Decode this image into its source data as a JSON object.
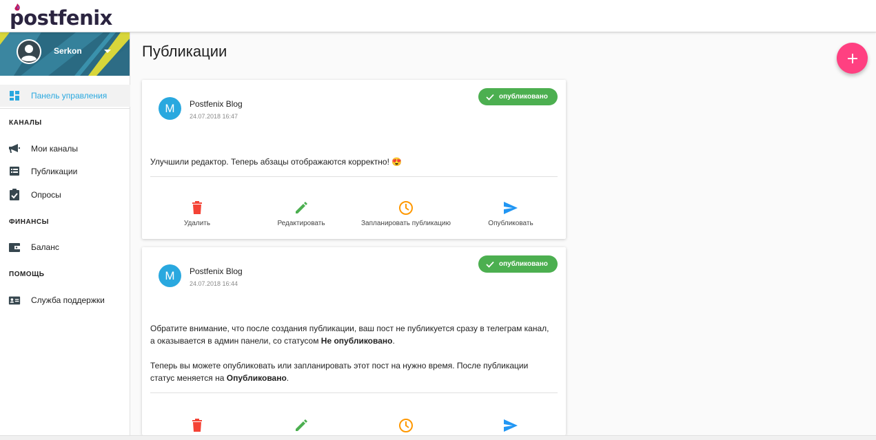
{
  "app": {
    "logo_text": "postfenix"
  },
  "user": {
    "name": "Serkon"
  },
  "sidebar": {
    "active": {
      "label": "Панель управления",
      "icon": "dashboard-icon"
    },
    "sections": [
      {
        "title": "КАНАЛЫ",
        "items": [
          {
            "label": "Мои каналы",
            "icon": "megaphone-icon"
          },
          {
            "label": "Публикации",
            "icon": "list-icon"
          },
          {
            "label": "Опросы",
            "icon": "clipboard-check-icon"
          }
        ]
      },
      {
        "title": "ФИНАНСЫ",
        "items": [
          {
            "label": "Баланс",
            "icon": "wallet-icon"
          }
        ]
      },
      {
        "title": "ПОМОЩЬ",
        "items": [
          {
            "label": "Служба поддержки",
            "icon": "contact-card-icon"
          }
        ]
      }
    ]
  },
  "main": {
    "title": "Публикации",
    "fab_label": "+"
  },
  "posts": [
    {
      "avatar_letter": "M",
      "author": "Postfenix Blog",
      "date": "24.07.2018 16:47",
      "status": "опубликовано",
      "text_line1": "Улучшили редактор. Теперь абзацы отображаются корректно! 😍"
    },
    {
      "avatar_letter": "M",
      "author": "Postfenix Blog",
      "date": "24.07.2018 16:44",
      "status": "опубликовано",
      "p1_line1": "Обратите внимание, что после создания публикации, ваш пост не публикуется сразу в телеграм канал,",
      "p1_line2_pre": "а оказывается в админ панели, со статусом ",
      "p1_line2_bold": "Не опубликовано",
      "p1_line2_post": ".",
      "p2_line1": "Теперь вы можете опубликовать или запланировать этот пост на нужно время. После публикации",
      "p2_line2_pre": "статус меняется на ",
      "p2_line2_bold": "Опубликовано",
      "p2_line2_post": "."
    }
  ],
  "actions": {
    "delete": "Удалить",
    "edit": "Редактировать",
    "schedule": "Запланировать публикацию",
    "publish": "Опубликовать"
  },
  "colors": {
    "accent": "#29a8df",
    "fab": "#ff4081",
    "published": "#4caf50",
    "delete": "#f44336",
    "edit": "#4caf50",
    "schedule": "#ff9800",
    "publish": "#2196f3"
  }
}
